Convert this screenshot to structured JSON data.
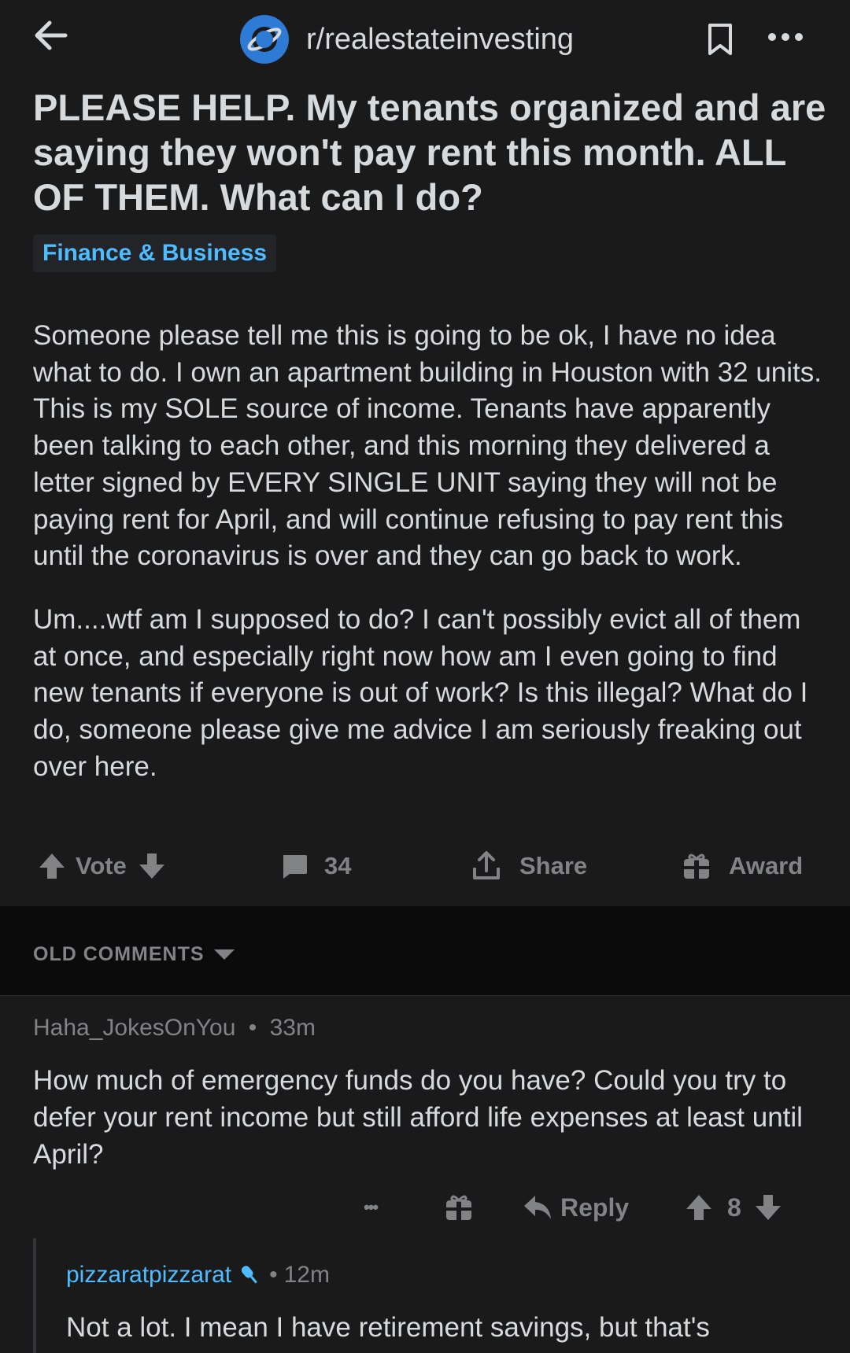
{
  "header": {
    "subreddit": "r/realestateinvesting",
    "icons": {
      "back": "arrow-left-icon",
      "subreddit": "subreddit-avatar-icon",
      "bookmark": "bookmark-icon",
      "more": "more-dots-icon"
    }
  },
  "post": {
    "title": "PLEASE HELP. My tenants organized and are saying they won't pay rent this month. ALL OF THEM. What can I do?",
    "flair": "Finance & Business",
    "paragraphs": [
      "Someone please tell me this is going to be ok, I have no idea what to do. I own an apartment building in Houston with 32 units. This is my SOLE source of income. Tenants have apparently been talking to each other, and this morning they delivered a letter signed by EVERY SINGLE UNIT saying they will not be paying rent for April, and will continue refusing to pay rent this until the coronavirus is over and they can go back to work.",
      "Um....wtf am I supposed to do? I can't possibly evict all of them at once, and especially right now how am I even going to find new tenants if everyone is out of work? Is this illegal? What do I do, someone please give me advice I am seriously freaking out over here."
    ],
    "actions": {
      "vote_label": "Vote",
      "comments_count": "34",
      "share_label": "Share",
      "award_label": "Award"
    }
  },
  "comments_sort": {
    "label": "OLD COMMENTS"
  },
  "comments": [
    {
      "username": "Haha_JokesOnYou",
      "separator": "•",
      "age": "33m",
      "body": "How much of emergency funds do you have? Could you try to defer your rent income but still afford life expenses at least until April?",
      "more_label": "•••",
      "reply_label": "Reply",
      "score": "8"
    },
    {
      "username": "pizzaratpizzarat",
      "separator": "•",
      "age": "12m",
      "body": "Not a lot. I mean I have retirement savings, but that's"
    }
  ],
  "colors": {
    "background": "#1a1a1b",
    "band": "#0b0b0c",
    "text": "#d7dadc",
    "muted": "#818384",
    "accent": "#4fbcff",
    "sub_icon": "#2d7bd4"
  }
}
